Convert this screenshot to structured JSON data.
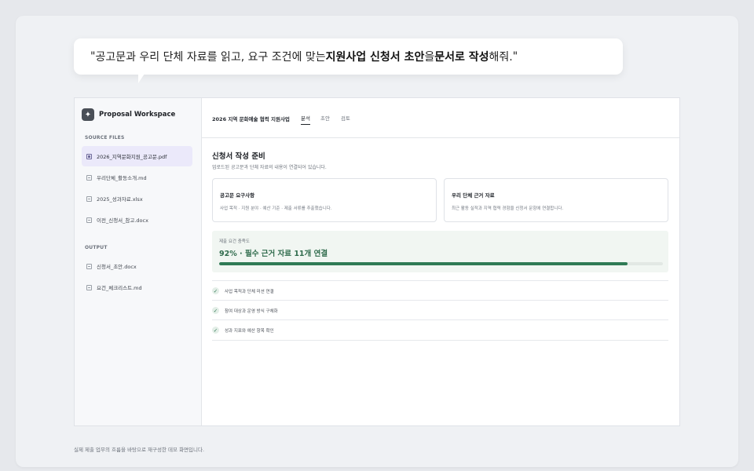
{
  "prompt": {
    "open_quote": "\"",
    "t1": "공고문과 우리 단체 자료를 읽고, 요구 조건에 맞는 ",
    "b1": "지원사업 신청서 초안",
    "t2": "을 ",
    "b2": "문서로 작성",
    "t3": "해줘.",
    "close_quote": "\""
  },
  "sidebar": {
    "brand": "Proposal Workspace",
    "brand_icon": "sparkle-icon",
    "source_label": "SOURCE FILES",
    "source_files": [
      "2026_지역문화지원_공고문.pdf",
      "우리단체_활동소개.md",
      "2025_성과자료.xlsx",
      "이전_신청서_참고.docx"
    ],
    "output_label": "OUTPUT",
    "output_files": [
      "신청서_초안.docx",
      "요건_체크리스트.md"
    ]
  },
  "topbar": {
    "project_title": "2026 지역 문화예술 협력 지원사업",
    "tabs": [
      "분석",
      "초안",
      "검토"
    ],
    "active_tab": "분석"
  },
  "main": {
    "title": "신청서 작성 준비",
    "subtitle": "업로드된 공고문과 단체 자료의 내용이 연결되어 있습니다.",
    "cards": [
      {
        "title": "공고문 요구사항",
        "desc": "사업 목적 · 지원 분야 · 예산 기준 · 제출 서류를 추출했습니다."
      },
      {
        "title": "우리 단체 근거 자료",
        "desc": "최근 활동 실적과 지역 협력 경험을 신청서 문항에 연결합니다."
      }
    ],
    "progress": {
      "label": "제출 요건 충족도",
      "value_text": "92% · 필수 근거 자료 11개 연결",
      "percent": 92
    },
    "checklist": [
      "사업 목적과 단체 미션 연결",
      "참여 대상과 운영 방식 구체화",
      "성과 지표와 예산 항목 확인"
    ]
  },
  "footer_note": "실제 제출 업무의 흐름을 바탕으로 재구성한 데모 화면입니다.",
  "colors": {
    "accent_green": "#2f7a55",
    "active_file_bg": "#ebe9fa"
  }
}
